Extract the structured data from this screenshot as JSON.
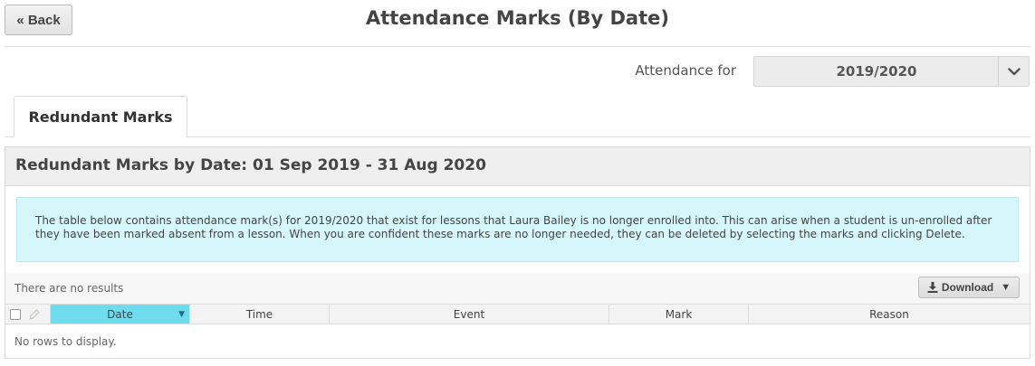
{
  "header": {
    "back_label": "« Back",
    "title": "Attendance Marks (By Date)"
  },
  "filter": {
    "label": "Attendance for",
    "selected_year": "2019/2020"
  },
  "tabs": [
    {
      "label": "Redundant Marks",
      "active": true
    }
  ],
  "panel": {
    "heading": "Redundant Marks by Date: 01 Sep 2019 - 31 Aug 2020",
    "info": "The table below contains attendance mark(s) for 2019/2020 that exist for lessons that Laura Bailey is no longer enrolled into. This can arise when a student is un-enrolled after they have been marked absent from a lesson. When you are confident these marks are no longer needed, they can be deleted by selecting the marks and clicking Delete.",
    "results_text": "There are no results",
    "download_label": "Download",
    "columns": [
      "Date",
      "Time",
      "Event",
      "Mark",
      "Reason"
    ],
    "empty_text": "No rows to display."
  },
  "colors": {
    "sorted_column": "#6fdcee",
    "info_background": "#d5f7fb"
  },
  "icons": {
    "download": "download-icon",
    "dropdown": "chevron-down-icon",
    "sort": "sort-down-icon",
    "edit": "pencil-icon"
  }
}
